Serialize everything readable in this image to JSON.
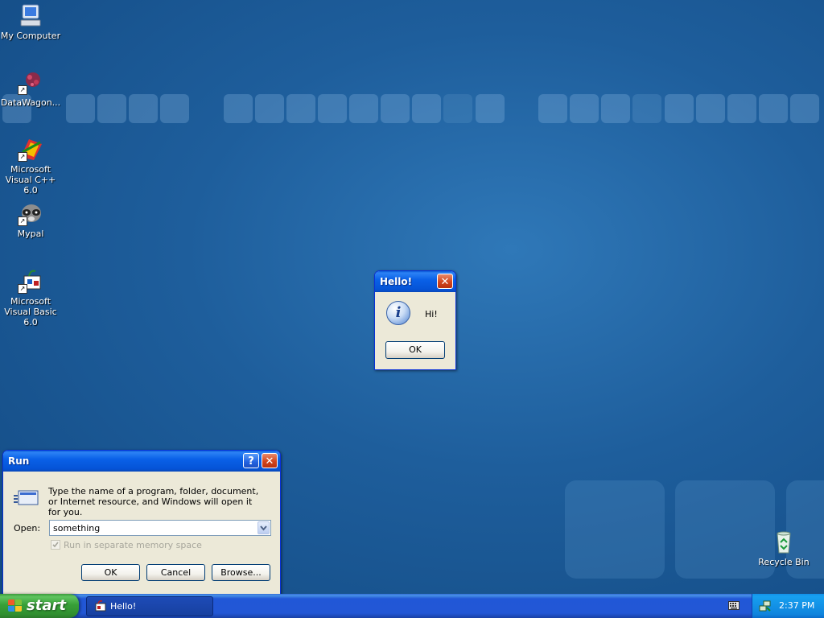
{
  "desktop": {
    "icons": [
      {
        "label": "My Computer",
        "icon": "my-computer-icon"
      },
      {
        "label": "DataWagon...",
        "icon": "datawagon-icon"
      },
      {
        "label": "Microsoft Visual C++ 6.0",
        "icon": "visual-cpp-icon"
      },
      {
        "label": "Mypal",
        "icon": "mypal-icon"
      },
      {
        "label": "Microsoft Visual Basic 6.0",
        "icon": "visual-basic-icon"
      },
      {
        "label": "Recycle Bin",
        "icon": "recycle-bin-icon"
      }
    ]
  },
  "hello_dialog": {
    "title": "Hello!",
    "message": "Hi!",
    "ok_label": "OK",
    "close_glyph": "✕",
    "info_glyph": "i"
  },
  "run_dialog": {
    "title": "Run",
    "help_glyph": "?",
    "close_glyph": "✕",
    "description": "Type the name of a program, folder, document, or Internet resource, and Windows will open it for you.",
    "open_label": "Open:",
    "open_value": "something",
    "checkbox_label": "Run in separate memory space",
    "checkbox_checked": true,
    "checkbox_enabled": false,
    "ok_label": "OK",
    "cancel_label": "Cancel",
    "browse_label": "Browse..."
  },
  "taskbar": {
    "start_label": "start",
    "tasks": [
      {
        "label": "Hello!",
        "icon": "app-task-icon"
      }
    ],
    "clock": "2:37 PM"
  },
  "colors": {
    "title_blue": "#0a5bd8",
    "dialog_face": "#ece9d8",
    "start_green": "#38a038",
    "close_red": "#d2451d"
  }
}
